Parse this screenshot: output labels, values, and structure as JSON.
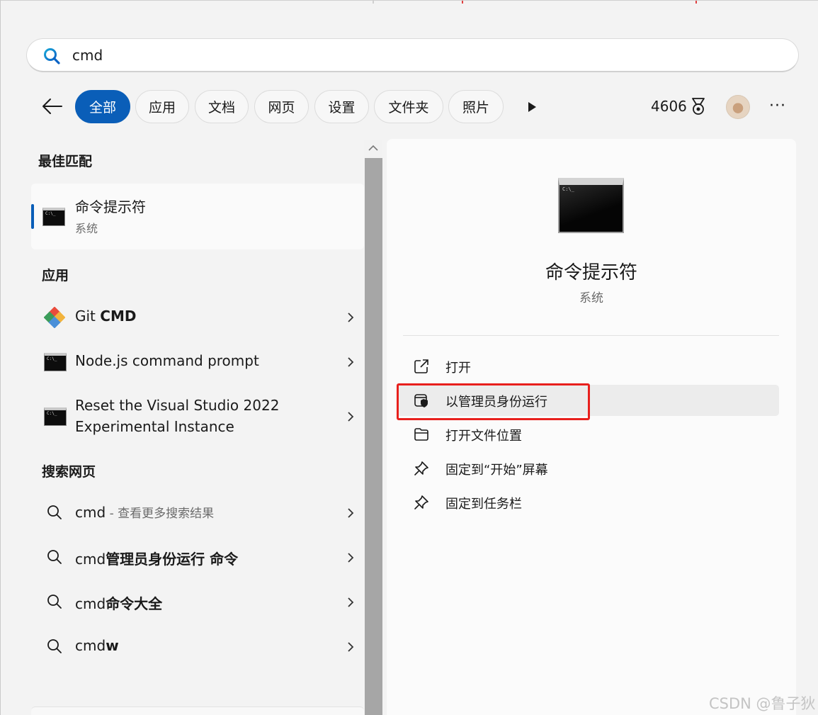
{
  "search": {
    "value": "cmd"
  },
  "filters": {
    "chips": [
      {
        "label": "全部",
        "active": true
      },
      {
        "label": "应用",
        "active": false
      },
      {
        "label": "文档",
        "active": false
      },
      {
        "label": "网页",
        "active": false
      },
      {
        "label": "设置",
        "active": false
      },
      {
        "label": "文件夹",
        "active": false
      },
      {
        "label": "照片",
        "active": false
      }
    ],
    "points": "4606"
  },
  "best_match": {
    "heading": "最佳匹配",
    "title": "命令提示符",
    "subtitle": "系统"
  },
  "apps": {
    "heading": "应用",
    "items": [
      {
        "prefix": "Git ",
        "bold": "CMD",
        "icon": "git-icon"
      },
      {
        "title": "Node.js command prompt",
        "icon": "cmd-icon"
      },
      {
        "line1": "Reset the Visual Studio 2022",
        "line2": "Experimental Instance",
        "icon": "cmd-icon"
      }
    ]
  },
  "web": {
    "heading": "搜索网页",
    "items": [
      {
        "text": "cmd",
        "hint": " - 查看更多搜索结果"
      },
      {
        "text": "cmd",
        "bold": "管理员身份运行 命令"
      },
      {
        "text": "cmd",
        "bold": "命令大全"
      },
      {
        "text": "cmd",
        "bold": "w"
      }
    ]
  },
  "detail": {
    "title": "命令提示符",
    "subtitle": "系统",
    "actions": [
      {
        "label": "打开",
        "icon": "open-external-icon"
      },
      {
        "label": "以管理员身份运行",
        "icon": "admin-shield-icon"
      },
      {
        "label": "打开文件位置",
        "icon": "folder-icon"
      },
      {
        "label": "固定到“开始”屏幕",
        "icon": "pin-icon"
      },
      {
        "label": "固定到任务栏",
        "icon": "pin-icon"
      }
    ]
  },
  "watermark": "CSDN @鲁子狄",
  "colors": {
    "accent": "#0a5eb8",
    "highlight_box": "#e8201d"
  }
}
